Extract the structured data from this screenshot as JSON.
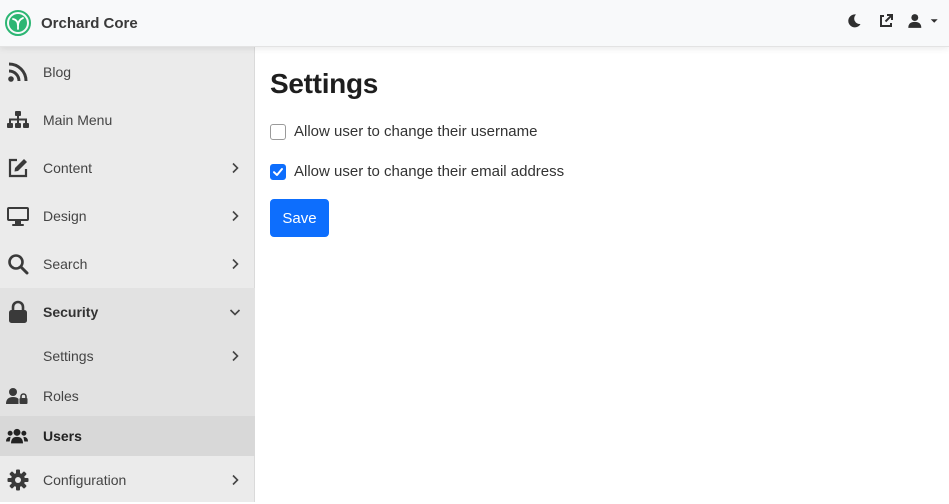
{
  "app": {
    "name": "Orchard Core"
  },
  "sidebar": {
    "items": [
      {
        "label": "Blog",
        "icon": "rss-icon"
      },
      {
        "label": "Main Menu",
        "icon": "sitemap-icon"
      },
      {
        "label": "Content",
        "icon": "edit-icon"
      },
      {
        "label": "Design",
        "icon": "desktop-icon"
      },
      {
        "label": "Search",
        "icon": "search-icon"
      },
      {
        "label": "Security",
        "icon": "lock-icon",
        "expanded": true
      },
      {
        "label": "Settings",
        "icon": ""
      },
      {
        "label": "Roles",
        "icon": "user-lock-icon"
      },
      {
        "label": "Users",
        "icon": "users-icon",
        "active": true
      },
      {
        "label": "Configuration",
        "icon": "cog-icon"
      }
    ]
  },
  "main": {
    "title": "Settings",
    "options": [
      {
        "label": "Allow user to change their username",
        "checked": false
      },
      {
        "label": "Allow user to change their email address",
        "checked": true
      }
    ],
    "save_label": "Save"
  },
  "colors": {
    "accent": "#0d6efd",
    "brand": "#2cb673",
    "sidebar_bg": "#ebebeb",
    "topbar_bg": "#f8f9fa"
  }
}
